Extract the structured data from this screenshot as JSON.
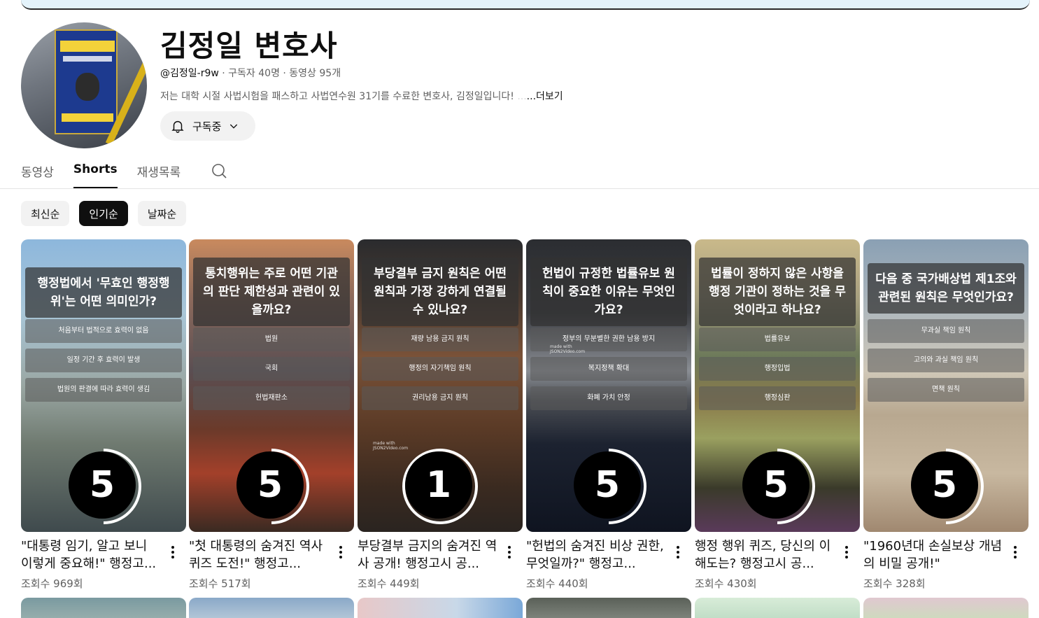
{
  "channel": {
    "name": "김정일 변호사",
    "handle": "@김정일-r9w",
    "stats": " · 구독자 40명 · 동영상 95개",
    "description": "저는 대학 시절 사법시험을 패스하고 사법연수원 31기를 수료한 변호사, 김정일입니다! ",
    "description_fade": "...",
    "more_label": "...더보기",
    "subscribe_label": "구독중",
    "avatar_icon": "channel-avatar"
  },
  "tabs": [
    {
      "label": "동영상",
      "active": false
    },
    {
      "label": "Shorts",
      "active": true
    },
    {
      "label": "재생목록",
      "active": false
    }
  ],
  "chips": [
    {
      "label": "최신순",
      "active": false
    },
    {
      "label": "인기순",
      "active": true
    },
    {
      "label": "날짜순",
      "active": false
    }
  ],
  "shorts": [
    {
      "question": "행정법에서 '무효인 행정행위'는 어떤 의미인가?",
      "options": [
        "처음부터 법적으로 효력이 없음",
        "일정 기간 후 효력이 발생",
        "법원의 판결에 따라 효력이 생김"
      ],
      "timer": "5",
      "title": "\"대통령 임기, 알고 보니 이렇게 중요해!\" 행정고...",
      "views": "조회수 969회"
    },
    {
      "question": "통치행위는 주로 어떤 기관의 판단 제한성과 관련이 있을까요?",
      "options": [
        "법원",
        "국회",
        "헌법재판소"
      ],
      "timer": "5",
      "title": "\"첫 대통령의 숨겨진 역사 퀴즈 도전!\" 행정고...",
      "views": "조회수 517회"
    },
    {
      "question": "부당결부 금지 원칙은 어떤 원칙과 가장 강하게 연결될 수 있나요?",
      "options": [
        "재량 남용 금지 원칙",
        "행정의 자기책임 원칙",
        "권리남용 금지 원칙"
      ],
      "timer": "1",
      "title": "부당결부 금지의 숨겨진 역사 공개! 행정고시 공...",
      "views": "조회수 449회",
      "watermark": "made with JSON2Video.com"
    },
    {
      "question": "헌법이 규정한 법률유보 원칙이 중요한 이유는 무엇인가요?",
      "options": [
        "정부의 무분별한 권한 남용 방지",
        "복지정책 확대",
        "화폐 가치 안정"
      ],
      "timer": "5",
      "title": "\"헌법의 숨겨진 비상 권한, 무엇일까?\" 행정고...",
      "views": "조회수 440회",
      "watermark": "made with JSON2Video.com"
    },
    {
      "question": "법률이 정하지 않은 사항을 행정 기관이 정하는 것을 무엇이라고 하나요?",
      "options": [
        "법률유보",
        "행정입법",
        "행정심판"
      ],
      "timer": "5",
      "title": "행정 행위 퀴즈, 당신의 이해도는? 행정고시 공...",
      "views": "조회수 430회"
    },
    {
      "question": "다음 중 국가배상법 제1조와 관련된 원칙은 무엇인가요?",
      "options": [
        "무과실 책임 원칙",
        "고의와 과실 책임 원칙",
        "면책 원칙"
      ],
      "timer": "5",
      "title": "\"1960년대 손실보상 개념의 비밀 공개!\"",
      "views": "조회수 328회"
    }
  ],
  "colors": {
    "text": "#0f0f0f",
    "secondary": "#606060",
    "chip_bg": "#f2f2f2",
    "chip_active_bg": "#0f0f0f"
  }
}
